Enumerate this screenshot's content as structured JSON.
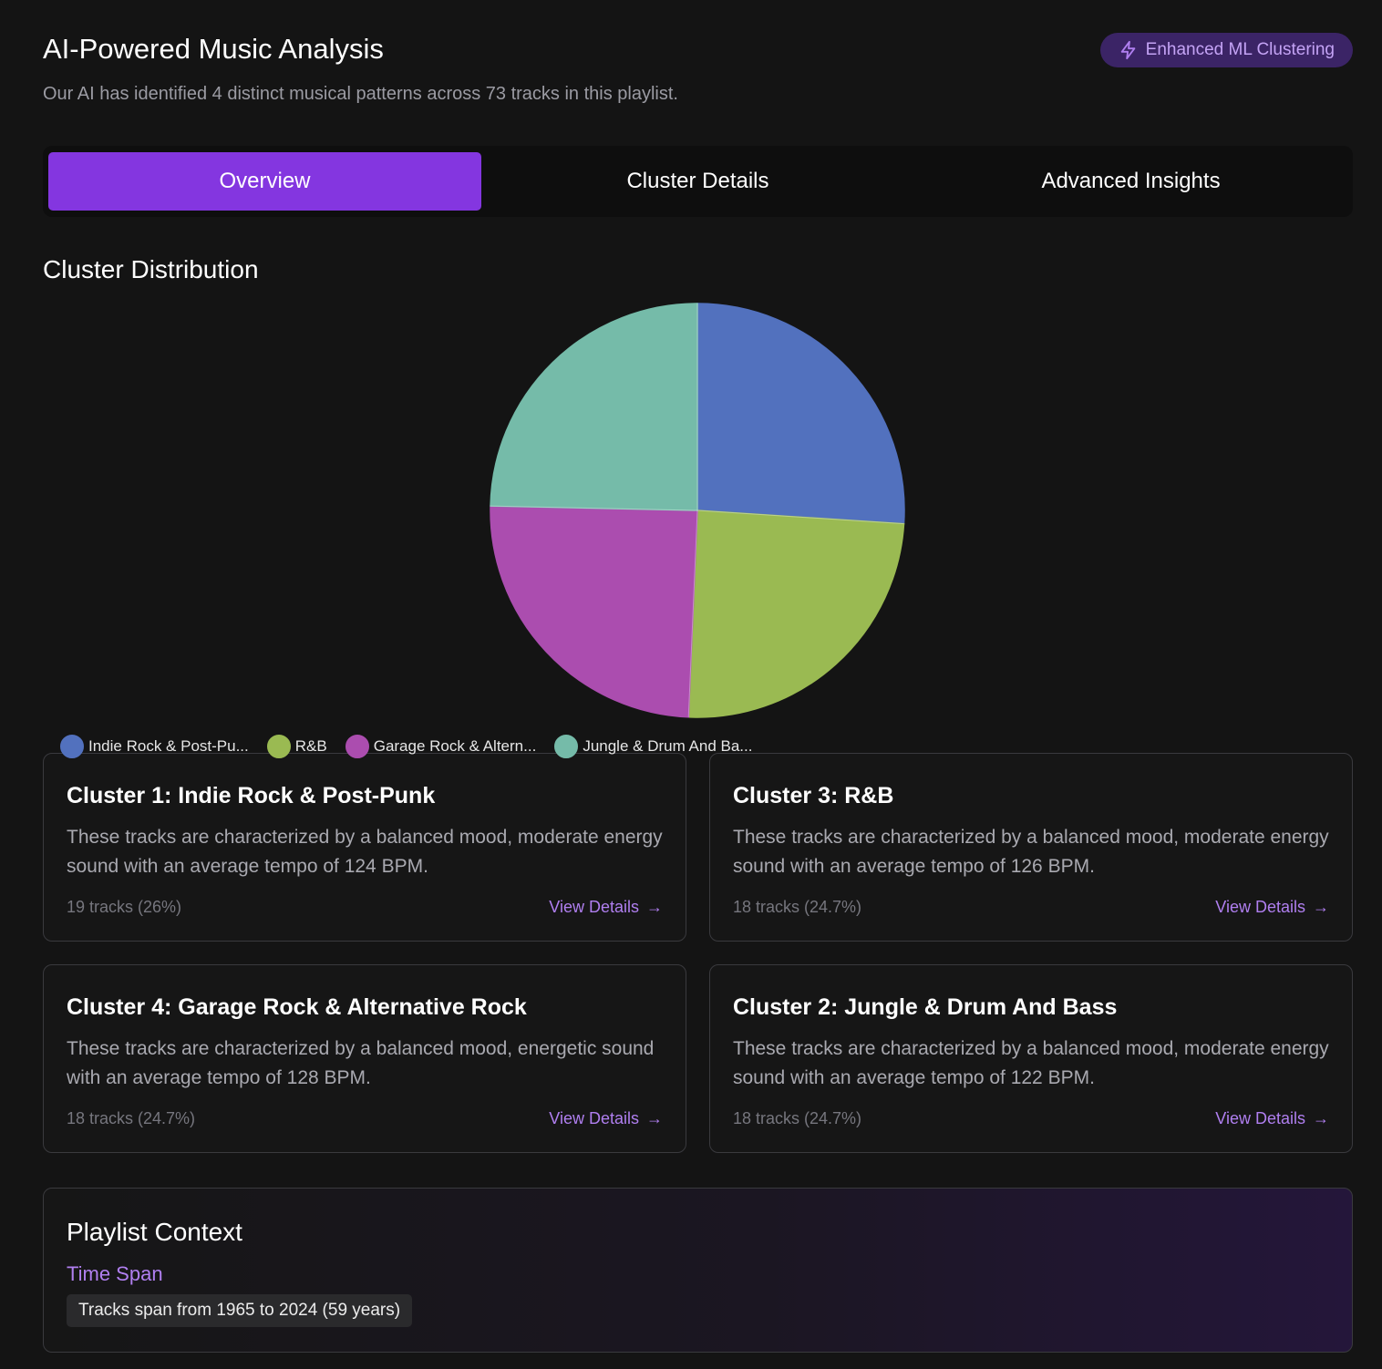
{
  "header": {
    "title": "AI-Powered Music Analysis",
    "subtitle": "Our AI has identified 4 distinct musical patterns across 73 tracks in this playlist.",
    "badge": {
      "label": "Enhanced ML Clustering",
      "icon": "lightning-icon"
    }
  },
  "tabs": [
    {
      "label": "Overview",
      "active": true
    },
    {
      "label": "Cluster Details",
      "active": false
    },
    {
      "label": "Advanced Insights",
      "active": false
    }
  ],
  "distribution": {
    "title": "Cluster Distribution"
  },
  "chart_data": {
    "type": "pie",
    "title": "",
    "start_angle_deg": 0,
    "direction": "clockwise",
    "slices": [
      {
        "label": "Indie Rock & Post-Pu...",
        "value": 19,
        "color": "#5271be"
      },
      {
        "label": "R&B",
        "value": 18,
        "color": "#9aba52"
      },
      {
        "label": "Garage Rock & Altern...",
        "value": 18,
        "color": "#ab4daf"
      },
      {
        "label": "Jungle & Drum And Ba...",
        "value": 18,
        "color": "#75bba9"
      }
    ],
    "legend_position": "bottom-left"
  },
  "clusters": [
    {
      "title": "Cluster 1: Indie Rock & Post-Punk",
      "description": "These tracks are characterized by a balanced mood, moderate energy sound with an average tempo of 124 BPM.",
      "count": "19 tracks (26%)",
      "link": "View Details"
    },
    {
      "title": "Cluster 3: R&B",
      "description": "These tracks are characterized by a balanced mood, moderate energy sound with an average tempo of 126 BPM.",
      "count": "18 tracks (24.7%)",
      "link": "View Details"
    },
    {
      "title": "Cluster 4: Garage Rock & Alternative Rock",
      "description": "These tracks are characterized by a balanced mood, energetic sound with an average tempo of 128 BPM.",
      "count": "18 tracks (24.7%)",
      "link": "View Details"
    },
    {
      "title": "Cluster 2: Jungle & Drum And Bass",
      "description": "These tracks are characterized by a balanced mood, moderate energy sound with an average tempo of 122 BPM.",
      "count": "18 tracks (24.7%)",
      "link": "View Details"
    }
  ],
  "context": {
    "title": "Playlist Context",
    "label": "Time Span",
    "value": "Tracks span from 1965 to 2024 (59 years)"
  },
  "colors": {
    "accent": "#8436e0",
    "link": "#b07ff0",
    "background": "#141414"
  }
}
